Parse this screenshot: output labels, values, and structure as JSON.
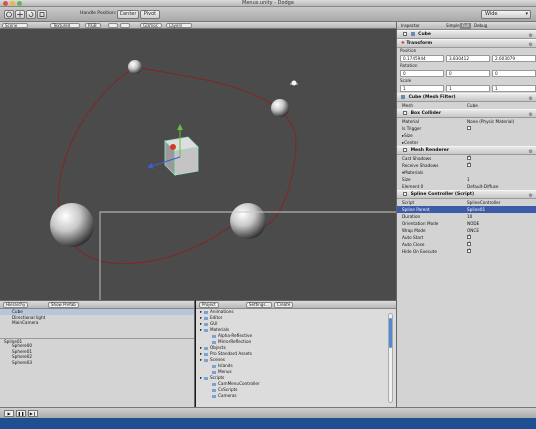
{
  "window": {
    "title": "Menus.unity - Dodge"
  },
  "toolbar": {
    "handle_position_label": "Handle Position:",
    "center_label": "Center",
    "pivot_label": "Pivot",
    "layout_value": "Wide"
  },
  "scene": {
    "view_mode": "Scene",
    "render_mode": "Textured",
    "rgb": "RGB",
    "persp_label": "Gizmos",
    "layers_label": "Layers"
  },
  "inspector": {
    "tabs": [
      "Inspector",
      "Simple",
      "Full",
      "Debug"
    ],
    "object_name": "Cube",
    "transform": {
      "title": "Transform",
      "position_label": "Position",
      "position": [
        "0.1745944",
        "3.830412",
        "2.603079"
      ],
      "rotation_label": "Rotation",
      "rotation": [
        "0",
        "0",
        "0"
      ],
      "scale_label": "Scale",
      "scale": [
        "1",
        "1",
        "1"
      ]
    },
    "mesh_filter": {
      "title": "Cube (Mesh Filter)",
      "mesh_label": "Mesh",
      "mesh_value": "Cube"
    },
    "box_collider": {
      "title": "Box Collider",
      "rows": [
        {
          "label": "Material",
          "value": "None (Physic Material)"
        },
        {
          "label": "Is Trigger",
          "value": ""
        },
        {
          "label": "▸Size",
          "value": ""
        },
        {
          "label": "▸Center",
          "value": ""
        }
      ]
    },
    "mesh_renderer": {
      "title": "Mesh Renderer",
      "rows": [
        {
          "label": "Cast Shadows",
          "value": ""
        },
        {
          "label": "Receive Shadows",
          "value": ""
        },
        {
          "label": "▾Materials",
          "value": ""
        },
        {
          "label": "Size",
          "value": "1"
        },
        {
          "label": "Element 0",
          "value": "Default-Diffuse"
        }
      ]
    },
    "spline": {
      "title": "Spline Controller (Script)",
      "rows": [
        {
          "label": "Script",
          "value": "SplineController"
        },
        {
          "label": "Spline Parent",
          "value": "Spline01"
        },
        {
          "label": "Duration",
          "value": "10"
        },
        {
          "label": "Orientation Mode",
          "value": "NODE"
        },
        {
          "label": "Wrap Mode",
          "value": "ONCE"
        },
        {
          "label": "Auto Start",
          "value": ""
        },
        {
          "label": "Auto Close",
          "value": ""
        },
        {
          "label": "Hide On Execute",
          "value": ""
        }
      ]
    }
  },
  "hierarchy": {
    "tab_label": "Hierarchy",
    "show_prefab_label": "Show Prefab",
    "items": [
      "Cube",
      "Directional light",
      "MainCamera"
    ],
    "group": "Spline01",
    "children": [
      "Sphere00",
      "Sphere01",
      "Sphere02",
      "Sphere03"
    ]
  },
  "project": {
    "tab_label": "Project",
    "settings_label": "Settings...",
    "create_label": "Create",
    "items": [
      {
        "label": "Animations",
        "depth": 0
      },
      {
        "label": "Editor",
        "depth": 0
      },
      {
        "label": "GUI",
        "depth": 0
      },
      {
        "label": "Materials",
        "depth": 0
      },
      {
        "label": "Alpha-Reflective",
        "depth": 1
      },
      {
        "label": "MirrorReflection",
        "depth": 1
      },
      {
        "label": "Objects",
        "depth": 0
      },
      {
        "label": "Pro Standard Assets",
        "depth": 0
      },
      {
        "label": "Scenes",
        "depth": 0
      },
      {
        "label": "Islands",
        "depth": 1
      },
      {
        "label": "Menus",
        "depth": 1
      },
      {
        "label": "Scripts",
        "depth": 0
      },
      {
        "label": "CamMenuController",
        "depth": 1
      },
      {
        "label": "CsScripts",
        "depth": 1
      },
      {
        "label": "Cameras",
        "depth": 1
      }
    ]
  },
  "colors": {
    "viewport_bg": "#4b4b4b",
    "spline_path": "#8a2020",
    "selection": "#3c5ba8",
    "dock": "#1e4f93"
  }
}
